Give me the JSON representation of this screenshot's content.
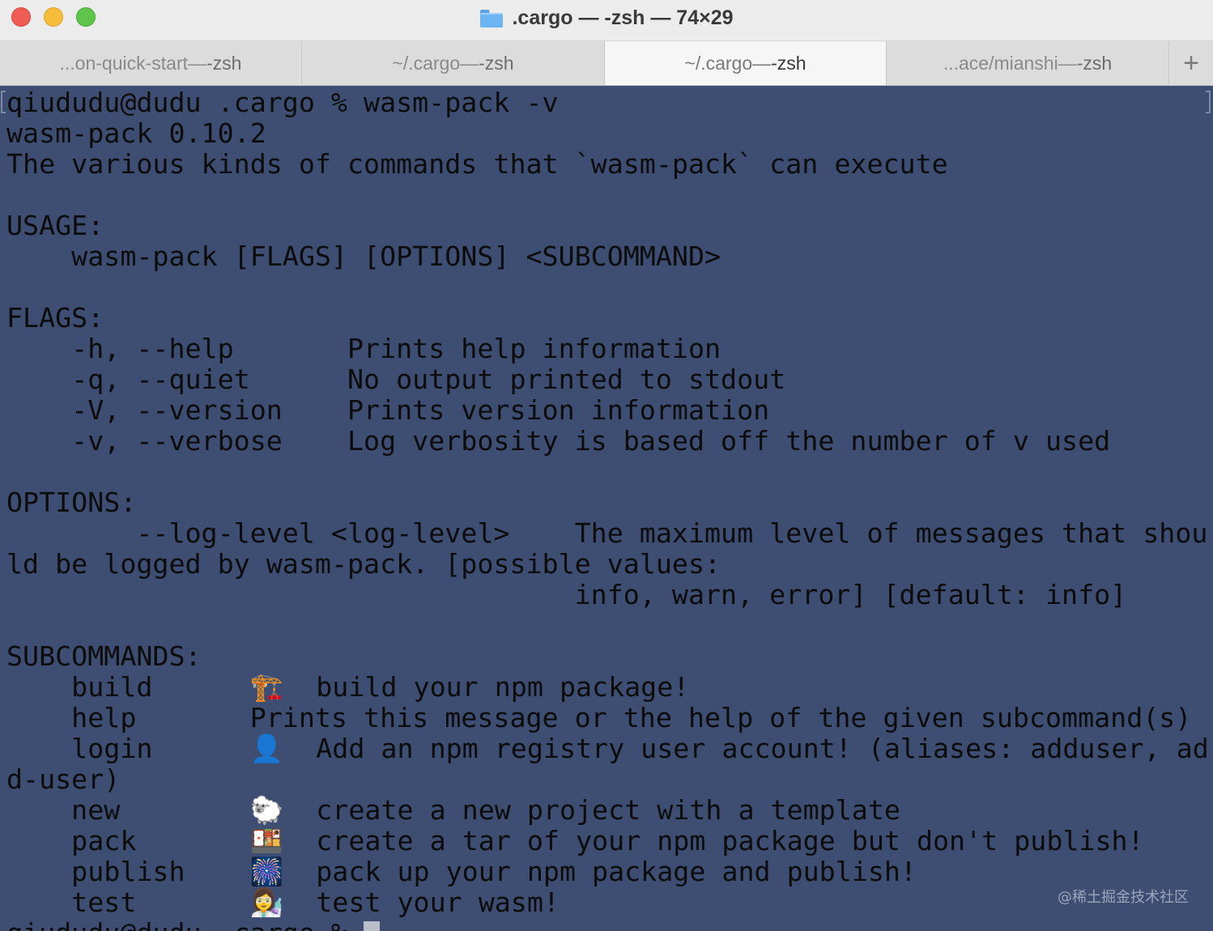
{
  "window": {
    "title": ".cargo — -zsh — 74×29",
    "folder_icon": "folder-icon"
  },
  "tabs": [
    {
      "label": "...on-quick-start",
      "suffix": " — ",
      "proc": "-zsh",
      "active": false
    },
    {
      "label": "~/.cargo",
      "suffix": " — ",
      "proc": "-zsh",
      "active": false
    },
    {
      "label": "~/.cargo",
      "suffix": " — ",
      "proc": "-zsh",
      "active": true
    },
    {
      "label": "...ace/mianshi",
      "suffix": " — ",
      "proc": "-zsh",
      "active": false
    }
  ],
  "new_tab_symbol": "+",
  "terminal": {
    "background": "#3d4e72",
    "lines": [
      "qiududu@dudu .cargo % wasm-pack -v",
      "wasm-pack 0.10.2",
      "The various kinds of commands that `wasm-pack` can execute",
      "",
      "USAGE:",
      "    wasm-pack [FLAGS] [OPTIONS] <SUBCOMMAND>",
      "",
      "FLAGS:",
      "    -h, --help       Prints help information",
      "    -q, --quiet      No output printed to stdout",
      "    -V, --version    Prints version information",
      "    -v, --verbose    Log verbosity is based off the number of v used",
      "",
      "OPTIONS:",
      "        --log-level <log-level>    The maximum level of messages that shou",
      "ld be logged by wasm-pack. [possible values:",
      "                                   info, warn, error] [default: info]",
      "",
      "SUBCOMMANDS:",
      "    build      🏗️  build your npm package!",
      "    help       Prints this message or the help of the given subcommand(s)",
      "    login      👤  Add an npm registry user account! (aliases: adduser, ad",
      "d-user)",
      "    new        🐑  create a new project with a template",
      "    pack       🍱  create a tar of your npm package but don't publish!",
      "    publish    🎆  pack up your npm package and publish!",
      "    test       👩‍🔬  test your wasm!",
      "qiududu@dudu .cargo % "
    ],
    "watermark": "@稀土掘金技术社区"
  }
}
